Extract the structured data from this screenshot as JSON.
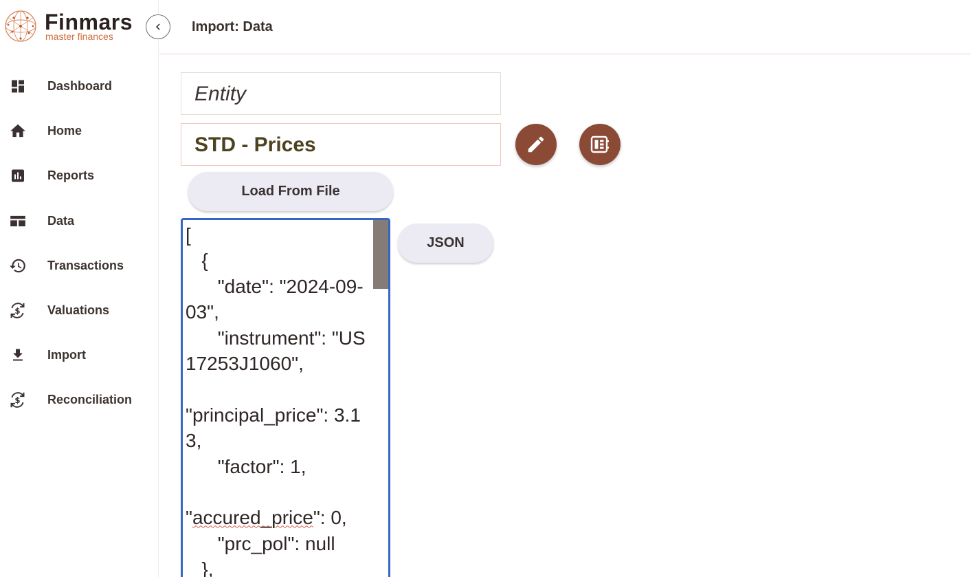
{
  "brand": {
    "name": "Finmars",
    "tagline": "master finances"
  },
  "sidebar": {
    "items": [
      {
        "label": "Dashboard",
        "icon": "dashboard-icon"
      },
      {
        "label": "Home",
        "icon": "home-icon"
      },
      {
        "label": "Reports",
        "icon": "reports-icon"
      },
      {
        "label": "Data",
        "icon": "table-icon"
      },
      {
        "label": "Transactions",
        "icon": "history-icon"
      },
      {
        "label": "Valuations",
        "icon": "currency-exchange-icon"
      },
      {
        "label": "Import",
        "icon": "download-icon"
      },
      {
        "label": "Reconciliation",
        "icon": "currency-exchange-icon"
      }
    ]
  },
  "header": {
    "title": "Import: Data"
  },
  "form": {
    "entity_label": "Entity",
    "scheme_value": "STD  - Prices",
    "load_button": "Load From File",
    "format_button": "JSON",
    "json_lines": {
      "l1": "[",
      "l2": "   {",
      "l3": "      \"date\": \"2024-09-03\",",
      "l4": "      \"instrument\": \"US17253J1060\",",
      "l5": "\"principal_price\": 3.13,",
      "l6": "      \"factor\": 1,",
      "l7a": "\"",
      "l7b": "accured_price",
      "l7c": "\": 0,",
      "l8": "      \"prc_pol\": null",
      "l9": "   },"
    }
  },
  "colors": {
    "accent_brown": "#8b4a35",
    "brand_orange": "#d06e3c",
    "focus_blue": "#3566c5"
  }
}
